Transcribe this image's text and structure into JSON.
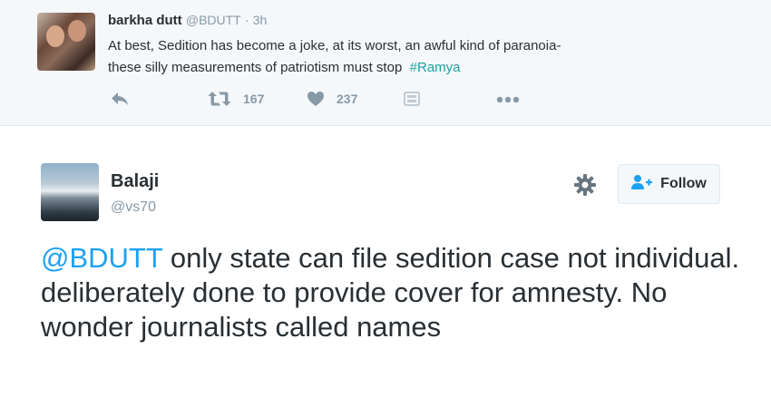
{
  "quoted_tweet": {
    "name": "barkha dutt",
    "handle": "@BDUTT",
    "separator": "·",
    "time": "3h",
    "text_line1": "At best, Sedition has become a joke, at its worst, an awful kind of paranoia-",
    "text_line2": "these silly measurements of patriotism must stop",
    "hashtag": "#Ramya",
    "actions": {
      "reply_icon": "reply-icon",
      "retweet_icon": "retweet-icon",
      "retweet_count": "167",
      "like_icon": "heart-icon",
      "like_count": "237",
      "media_icon": "media-icon",
      "more_icon": "more-dots-icon"
    }
  },
  "main_tweet": {
    "name": "Balaji",
    "handle": "@vs70",
    "settings_icon": "gear-icon",
    "follow_label": "Follow",
    "mention": "@BDUTT",
    "text": " only state can file sedition case not individual.  deliberately done to provide cover for amnesty. No wonder journalists called names"
  },
  "colors": {
    "link_blue": "#1da1f2",
    "hashtag_teal": "#1da1a0",
    "muted": "#8899a6",
    "text": "#292f33",
    "quoted_bg": "#f5f8fa"
  }
}
